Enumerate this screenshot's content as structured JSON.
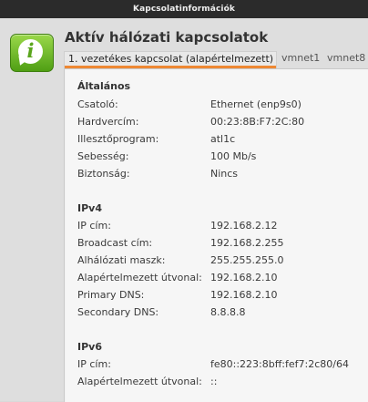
{
  "window": {
    "title": "Kapcsolatinformációk"
  },
  "heading": "Aktív hálózati kapcsolatok",
  "tabs": [
    {
      "label": "1. vezetékes kapcsolat (alapértelmezett)",
      "active": true
    },
    {
      "label": "vmnet1",
      "active": false
    },
    {
      "label": "vmnet8",
      "active": false
    }
  ],
  "general": {
    "title": "Általános",
    "rows": [
      {
        "label": "Csatoló:",
        "value": "Ethernet (enp9s0)"
      },
      {
        "label": "Hardvercím:",
        "value": "00:23:8B:F7:2C:80"
      },
      {
        "label": "Illesztőprogram:",
        "value": "atl1c"
      },
      {
        "label": "Sebesség:",
        "value": "100 Mb/s"
      },
      {
        "label": "Biztonság:",
        "value": "Nincs"
      }
    ]
  },
  "ipv4": {
    "title": "IPv4",
    "rows": [
      {
        "label": "IP cím:",
        "value": "192.168.2.12"
      },
      {
        "label": "Broadcast cím:",
        "value": "192.168.2.255"
      },
      {
        "label": "Alhálózati maszk:",
        "value": "255.255.255.0"
      },
      {
        "label": "Alapértelmezett útvonal:",
        "value": "192.168.2.10"
      },
      {
        "label": "Primary DNS:",
        "value": "192.168.2.10"
      },
      {
        "label": "Secondary DNS:",
        "value": "8.8.8.8"
      }
    ]
  },
  "ipv6": {
    "title": "IPv6",
    "rows": [
      {
        "label": "IP cím:",
        "value": "fe80::223:8bff:fef7:2c80/64"
      },
      {
        "label": "Alapértelmezett útvonal:",
        "value": "::"
      }
    ]
  },
  "colors": {
    "titlebar": "#2b2b2b",
    "tab_accent": "#ee8833",
    "icon_green": "#5aa51d"
  },
  "icons": {
    "info": "info-icon"
  }
}
